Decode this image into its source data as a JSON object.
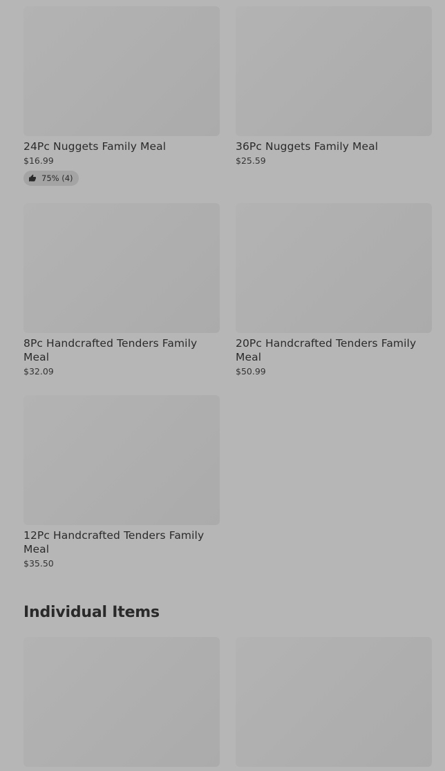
{
  "family_meals": [
    {
      "name": "24Pc Nuggets Family Meal",
      "price": "$16.99",
      "rating": {
        "percent": "75%",
        "count": "(4)"
      }
    },
    {
      "name": "36Pc Nuggets Family Meal",
      "price": "$25.59"
    },
    {
      "name": "8Pc Handcrafted Tenders Family Meal",
      "price": "$32.09"
    },
    {
      "name": "20Pc Handcrafted Tenders Family Meal",
      "price": "$50.99"
    },
    {
      "name": "12Pc Handcrafted Tenders Family Meal",
      "price": "$35.50"
    }
  ],
  "individual_items": {
    "title": "Individual Items"
  },
  "icons": {
    "rating": "thumbs-up-icon"
  }
}
